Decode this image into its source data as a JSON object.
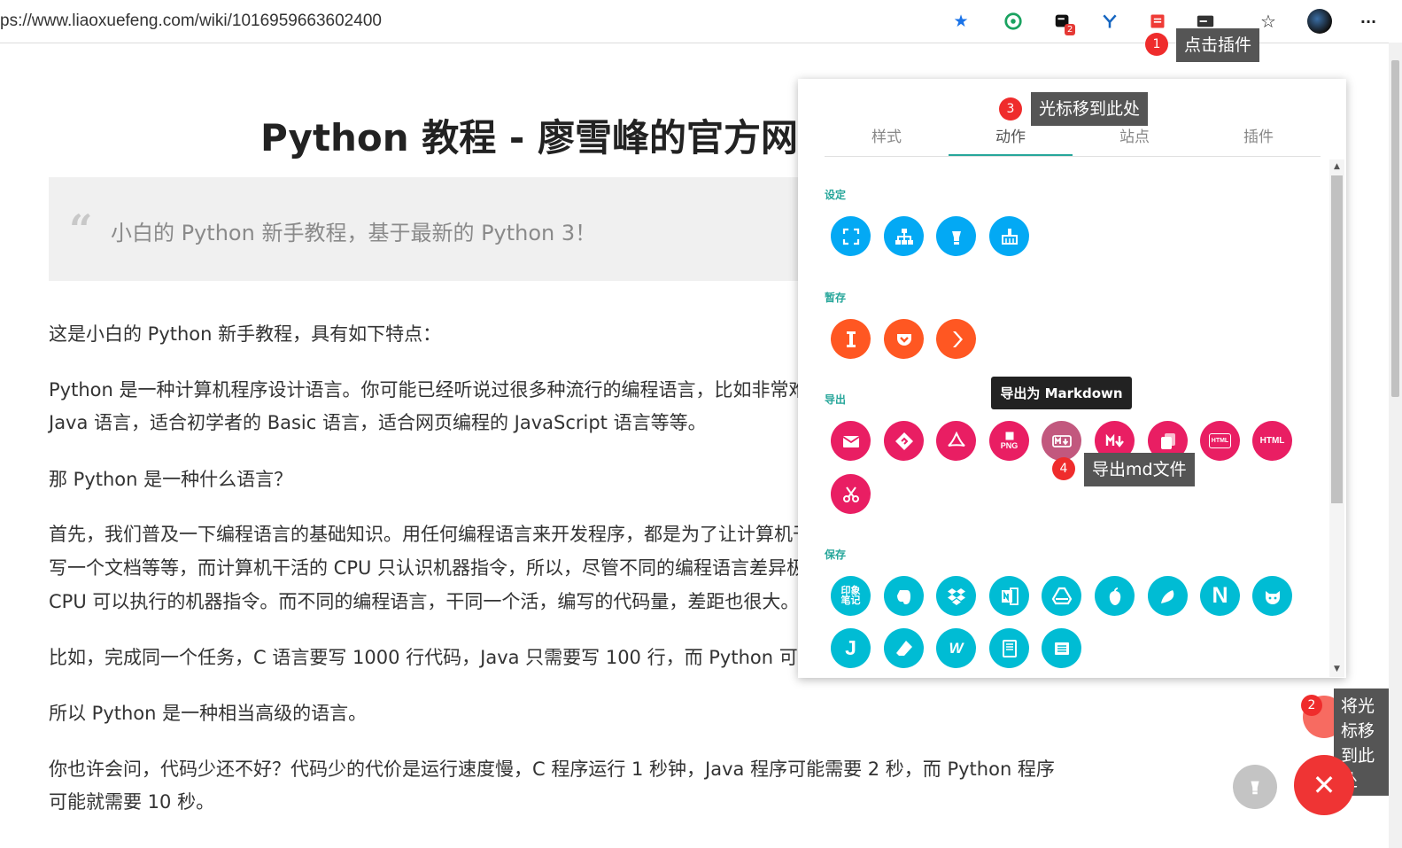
{
  "browser": {
    "url": "ps://www.liaoxuefeng.com/wiki/1016959663602400",
    "extension_badge": "2",
    "menu_label": "···"
  },
  "article": {
    "title": "Python 教程 - 廖雪峰的官方网",
    "quote_mark": "“",
    "quote": "小白的 Python 新手教程，基于最新的 Python 3！",
    "paragraphs": [
      "这是小白的 Python 新手教程，具有如下特点：",
      "Python 是一种计算机程序设计语言。你可能已经听说过很多种流行的编程语言，比如非常难",
      "Java 语言，适合初学者的 Basic 语言，适合网页编程的 JavaScript 语言等等。",
      "那 Python 是一种什么语言？",
      "首先，我们普及一下编程语言的基础知识。用任何编程语言来开发程序，都是为了让计算机干",
      "写一个文档等等，而计算机干活的 CPU 只认识机器指令，所以，尽管不同的编程语言差异极",
      "CPU 可以执行的机器指令。而不同的编程语言，干同一个活，编写的代码量，差距也很大。",
      "比如，完成同一个任务，C 语言要写 1000 行代码，Java 只需要写 100 行，而 Python 可能",
      "所以 Python 是一种相当高级的语言。",
      "你也许会问，代码少还不好？代码少的代价是运行速度慢，C 程序运行 1 秒钟，Java 程序可能需要 2 秒，而 Python 程序",
      "可能就需要 10 秒。"
    ]
  },
  "popup": {
    "tabs": [
      "样式",
      "动作",
      "站点",
      "插件"
    ],
    "active_tab": "动作",
    "sections": {
      "settings": "设定",
      "cache": "暂存",
      "export": "导出",
      "save": "保存"
    },
    "export_icons": {
      "png": "PNG",
      "html1": "HTML",
      "html2": "HTML"
    },
    "save_icons": {
      "yinxiang": "印象笔记",
      "notion": "N",
      "jianguo": "J",
      "wiz": "W"
    },
    "hover_tooltip": "导出为 Markdown"
  },
  "annotations": {
    "step1": {
      "num": "1",
      "text": "点击插件"
    },
    "step2": {
      "num": "2",
      "text": "将光标移到此处"
    },
    "step3": {
      "num": "3",
      "text": "光标移到此处"
    },
    "step4": {
      "num": "4",
      "text": "导出md文件"
    }
  },
  "colors": {
    "accent": "#26a69a",
    "settings_icons": "#03a9f4",
    "cache_icons": "#ff5722",
    "export_icons": "#e91e63",
    "save_icons": "#00bcd4"
  }
}
